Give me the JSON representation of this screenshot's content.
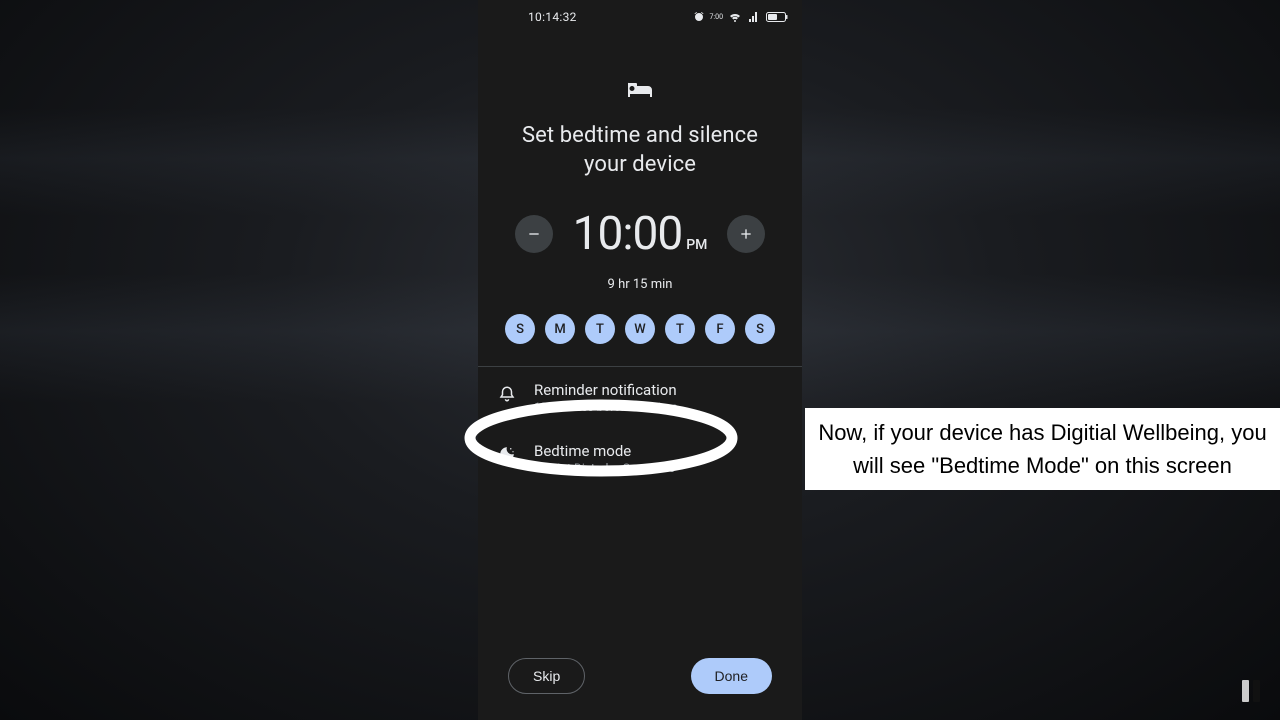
{
  "status": {
    "time": "10:14:32",
    "alarm": "7:00"
  },
  "hero": {
    "title": "Set bedtime and silence your device"
  },
  "time": {
    "value": "10:00",
    "ampm": "PM",
    "duration": "9 hr 15 min"
  },
  "days": [
    "S",
    "M",
    "T",
    "W",
    "T",
    "F",
    "S"
  ],
  "options": {
    "reminder": {
      "title": "Reminder notification",
      "sub": "15 minutes before bedtime"
    },
    "bedtime": {
      "title": "Bedtime mode",
      "sub": "Do Not Disturb • Grayscale"
    }
  },
  "buttons": {
    "skip": "Skip",
    "done": "Done"
  },
  "caption": "Now, if your device has Digitial Wellbeing, you will see \"Bedtime Mode\" on this screen"
}
